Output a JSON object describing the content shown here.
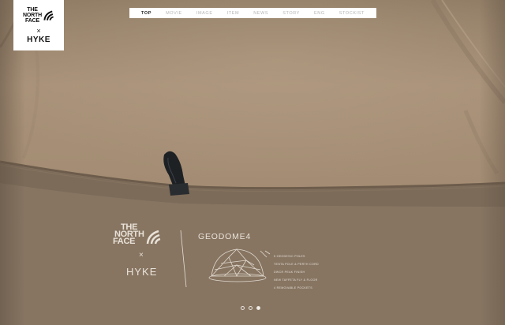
{
  "brand": {
    "tnf_lines": [
      "THE",
      "NORTH",
      "FACE"
    ],
    "times": "×",
    "hyke": "HYKE"
  },
  "nav": {
    "items": [
      {
        "label": "TOP",
        "active": true
      },
      {
        "label": "MOVIE",
        "active": false
      },
      {
        "label": "IMAGE",
        "active": false
      },
      {
        "label": "ITEM",
        "active": false
      },
      {
        "label": "NEWS",
        "active": false
      },
      {
        "label": "STORY",
        "active": false
      },
      {
        "label": "ENG",
        "active": false
      },
      {
        "label": "STOCKIST",
        "active": false
      }
    ]
  },
  "print": {
    "tnf_lines": [
      "THE",
      "NORTH",
      "FACE"
    ],
    "times": "×",
    "hyke": "HYKE",
    "model": "GEODOME4",
    "specs": [
      "5 GEODESIC POLES",
      "TENTA POLE & PERTH CORD",
      "DWCR PEAK FINISH",
      "NEW TAFFETA FLY & FLOOR",
      "4 REMOVABLE POCKETS"
    ]
  },
  "slider": {
    "count": 3,
    "active_index": 2
  },
  "colors": {
    "tent_upper": "#a38d74",
    "tent_lower": "#857361",
    "print": "#e9e2d8",
    "nav_active": "#222222",
    "nav_inactive": "#b5b5b5"
  }
}
